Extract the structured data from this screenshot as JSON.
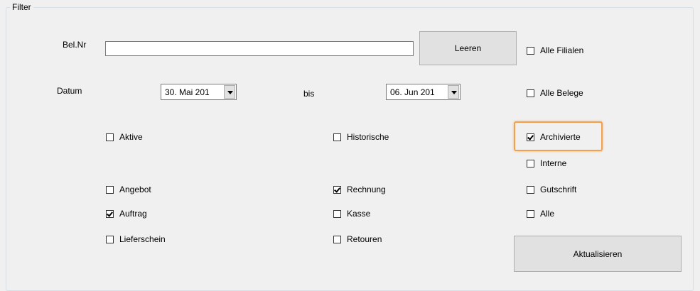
{
  "filter": {
    "group_title": "Filter",
    "belnr_label": "Bel.Nr",
    "belnr_value": "",
    "leeren_label": "Leeren",
    "datum_label": "Datum",
    "date_from": "30. Mai 201",
    "bis_label": "bis",
    "date_to": "06. Jun 201",
    "aktualisieren_label": "Aktualisieren",
    "checkboxes": {
      "alle_filialen": {
        "label": "Alle Filialen",
        "checked": false
      },
      "alle_belege": {
        "label": "Alle Belege",
        "checked": false
      },
      "aktive": {
        "label": "Aktive",
        "checked": false
      },
      "historische": {
        "label": "Historische",
        "checked": false
      },
      "archivierte": {
        "label": "Archivierte",
        "checked": true
      },
      "interne": {
        "label": "Interne",
        "checked": false
      },
      "angebot": {
        "label": "Angebot",
        "checked": false
      },
      "rechnung": {
        "label": "Rechnung",
        "checked": true
      },
      "gutschrift": {
        "label": "Gutschrift",
        "checked": false
      },
      "auftrag": {
        "label": "Auftrag",
        "checked": true
      },
      "kasse": {
        "label": "Kasse",
        "checked": false
      },
      "alle": {
        "label": "Alle",
        "checked": false
      },
      "lieferschein": {
        "label": "Lieferschein",
        "checked": false
      },
      "retouren": {
        "label": "Retouren",
        "checked": false
      }
    }
  },
  "colors": {
    "background": "#f0f0f0",
    "highlight_border": "#f0a050"
  }
}
